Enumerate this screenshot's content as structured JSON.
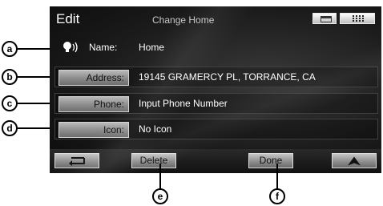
{
  "header": {
    "title": "Edit",
    "subtitle": "Change Home"
  },
  "rows": {
    "name": {
      "label": "Name:",
      "value": "Home"
    },
    "address": {
      "label": "Address:",
      "value": "19145 GRAMERCY PL, TORRANCE, CA"
    },
    "phone": {
      "label": "Phone:",
      "value": "Input Phone Number"
    },
    "icon": {
      "label": "Icon:",
      "value": "No Icon"
    }
  },
  "bottom": {
    "delete_label": "Delete",
    "done_label": "Done"
  },
  "callouts": {
    "a": "a",
    "b": "b",
    "c": "c",
    "d": "d",
    "e": "e",
    "f": "f"
  },
  "icons": {
    "speaker": "speaker-icon",
    "window": "window-icon",
    "grid": "grid-icon",
    "back": "back-arrow-icon",
    "map": "map-arrow-icon"
  }
}
